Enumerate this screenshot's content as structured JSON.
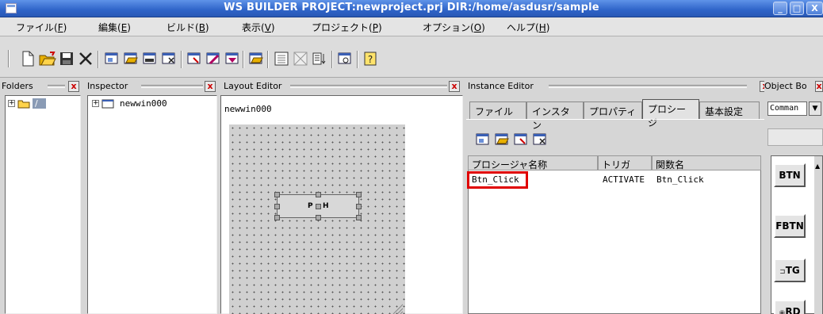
{
  "window": {
    "title": "WS BUILDER PROJECT:newproject.prj DIR:/home/asdusr/sample"
  },
  "menu": [
    {
      "label": "ファイル(",
      "key": "F",
      "tail": ")"
    },
    {
      "label": "編集(",
      "key": "E",
      "tail": ")"
    },
    {
      "label": "ビルド(",
      "key": "B",
      "tail": ")"
    },
    {
      "label": "表示(",
      "key": "V",
      "tail": ")"
    },
    {
      "label": "プロジェクト(",
      "key": "P",
      "tail": ")"
    },
    {
      "label": "オプション(",
      "key": "O",
      "tail": ")"
    },
    {
      "label": "ヘルプ(",
      "key": "H",
      "tail": ")"
    }
  ],
  "toolbar_icons": [
    "new-file-icon",
    "open-folder-icon",
    "save-icon",
    "delete-icon",
    "new-window-icon",
    "open-window-icon",
    "window-icon",
    "window-select-icon",
    "window-list-icon",
    "wizard-icon",
    "build-icon",
    "folder-select-icon",
    "calendar-icon",
    "grid-icon",
    "list-sort-icon",
    "preview-icon",
    "help-icon"
  ],
  "panels": {
    "folders": {
      "title": "Folders",
      "root_label": "/"
    },
    "inspector": {
      "title": "Inspector",
      "node_label": "newwin000"
    },
    "layout_editor": {
      "title": "Layout Editor",
      "window_name": "newwin000",
      "widget_label": "P",
      "widget_label2": "H"
    },
    "instance_editor": {
      "title": "Instance Editor",
      "tabs": [
        "ファイル",
        "インスタン",
        "プロパティ",
        "プロシージ",
        "基本設定"
      ],
      "active_tab": "プロシージ",
      "columns": [
        "プロシージャ名称",
        "トリガ",
        "関数名"
      ],
      "rows": [
        {
          "name": "Btn_Click",
          "trigger": "ACTIVATE",
          "func": "Btn_Click",
          "highlighted": true
        }
      ]
    },
    "object_box": {
      "title": "Object Bo",
      "select_value": "Comman",
      "items": [
        "BTN",
        "FBTN",
        "TG",
        "RD"
      ]
    }
  },
  "colors": {
    "titlebar": "#2f64c8",
    "highlight_box": "#e00000"
  }
}
